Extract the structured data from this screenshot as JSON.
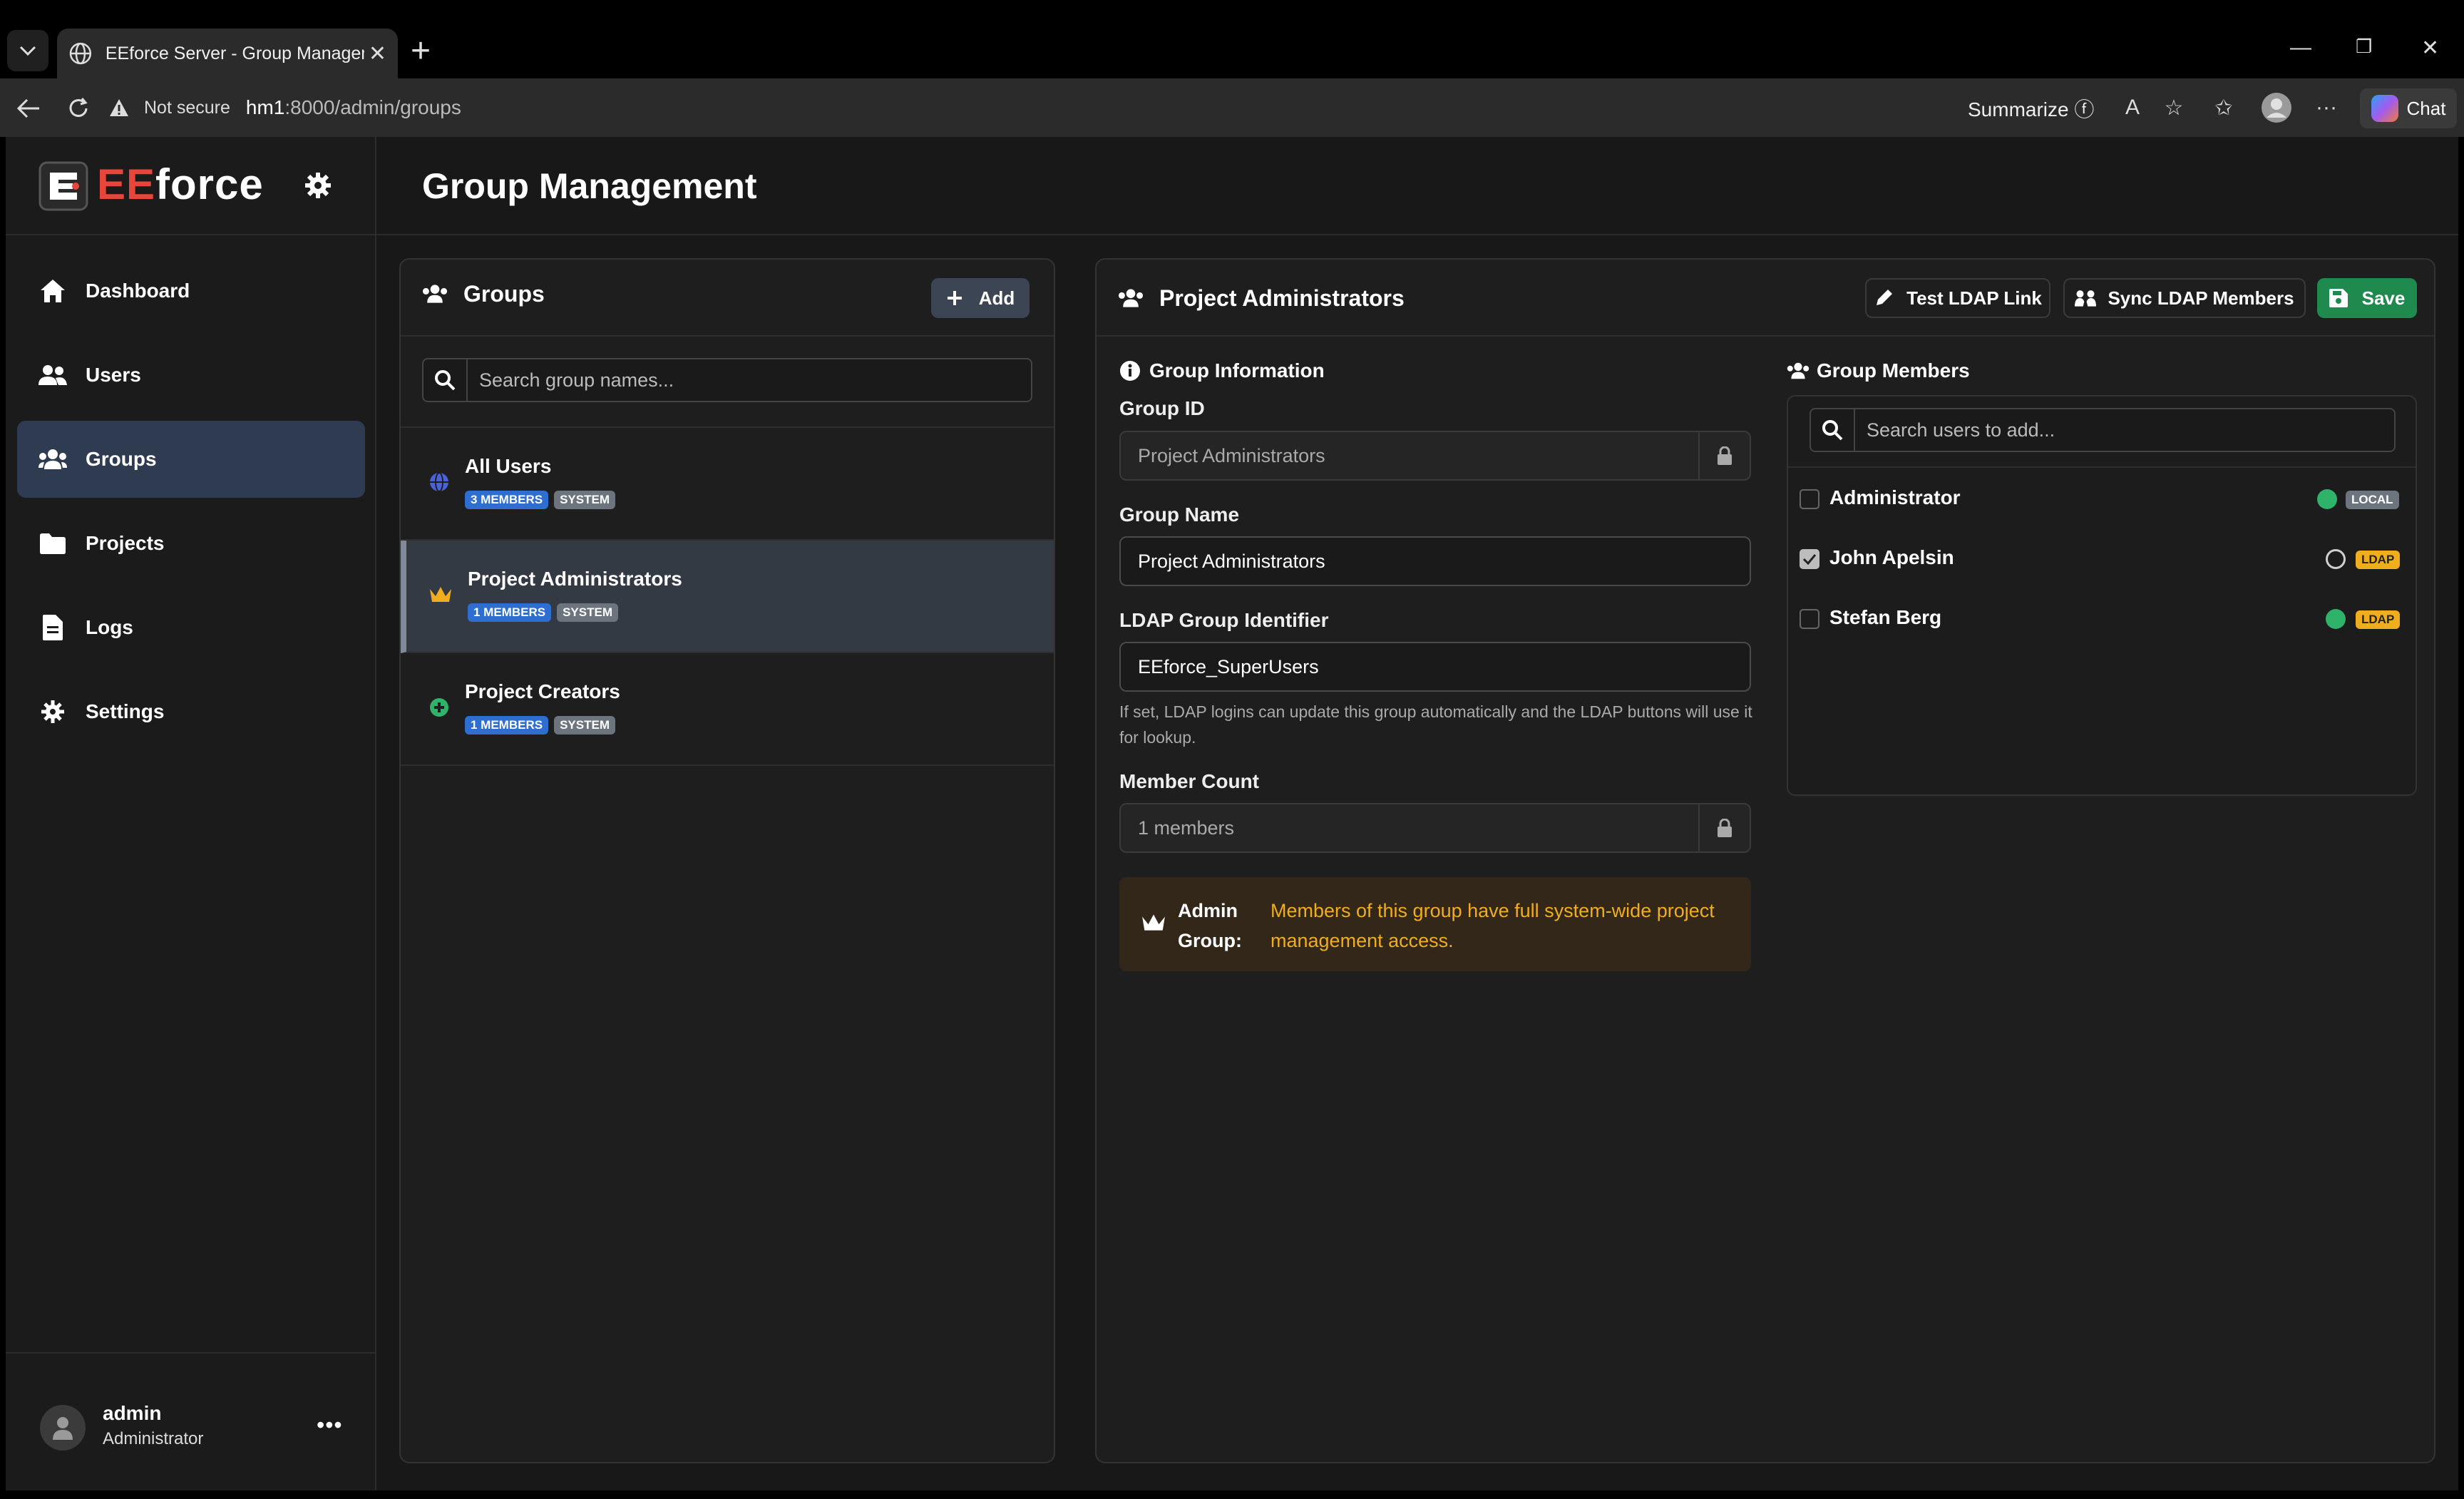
{
  "browser": {
    "tab_title": "EEforce Server - Group Manageme",
    "not_secure": "Not secure",
    "url_host": "hm1",
    "url_path": ":8000/admin/groups",
    "summarize": "Summarize",
    "chat": "Chat"
  },
  "brand": {
    "ee": "EE",
    "force": "force"
  },
  "sidebar": {
    "items": [
      {
        "label": "Dashboard",
        "icon": "home-icon"
      },
      {
        "label": "Users",
        "icon": "users-icon"
      },
      {
        "label": "Groups",
        "icon": "groups-icon",
        "active": true
      },
      {
        "label": "Projects",
        "icon": "folder-icon"
      },
      {
        "label": "Logs",
        "icon": "file-icon"
      },
      {
        "label": "Settings",
        "icon": "gear-icon"
      }
    ],
    "user": {
      "name": "admin",
      "role": "Administrator",
      "more": "•••"
    }
  },
  "page": {
    "title": "Group Management"
  },
  "groups_panel": {
    "title": "Groups",
    "add_label": "Add",
    "search_placeholder": "Search group names...",
    "groups": [
      {
        "name": "All Users",
        "members_badge": "3 MEMBERS",
        "type_badge": "SYSTEM",
        "icon": "globe-icon"
      },
      {
        "name": "Project Administrators",
        "members_badge": "1 MEMBERS",
        "type_badge": "SYSTEM",
        "icon": "crown-icon",
        "active": true
      },
      {
        "name": "Project Creators",
        "members_badge": "1 MEMBERS",
        "type_badge": "SYSTEM",
        "icon": "plus-circle-icon"
      }
    ]
  },
  "detail": {
    "title": "Project Administrators",
    "test_ldap_label": "Test LDAP Link",
    "sync_ldap_label": "Sync LDAP Members",
    "save_label": "Save",
    "info_title": "Group Information",
    "group_id_label": "Group ID",
    "group_id_value": "Project Administrators",
    "group_name_label": "Group Name",
    "group_name_value": "Project Administrators",
    "ldap_label": "LDAP Group Identifier",
    "ldap_value": "EEforce_SuperUsers",
    "ldap_help": "If set, LDAP logins can update this group automatically and the LDAP buttons will use it for lookup.",
    "member_count_label": "Member Count",
    "member_count_value": "1 members",
    "admin_alert_label": "Admin Group:",
    "admin_alert_msg": "Members of this group have full system-wide project management access.",
    "members_title": "Group Members",
    "members_search_placeholder": "Search users to add...",
    "members": [
      {
        "name": "Administrator",
        "checked": false,
        "online": true,
        "source": "LOCAL"
      },
      {
        "name": "John Apelsin",
        "checked": true,
        "online": false,
        "source": "LDAP"
      },
      {
        "name": "Stefan Berg",
        "checked": false,
        "online": true,
        "source": "LDAP"
      }
    ]
  },
  "colors": {
    "accent_green": "#1e8a4e",
    "brand_red": "#e8463b",
    "warning": "#f0ad1e",
    "badge_blue": "#2f6ed1"
  }
}
